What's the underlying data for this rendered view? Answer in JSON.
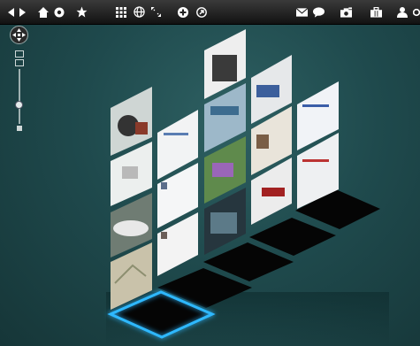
{
  "toolbar": {
    "left": [
      {
        "name": "back-icon"
      },
      {
        "name": "forward-icon"
      },
      {
        "name": "home-icon"
      },
      {
        "name": "history-icon"
      },
      {
        "name": "bookmark-star-icon"
      }
    ],
    "center": [
      {
        "name": "grid-view-icon"
      },
      {
        "name": "globe-icon"
      },
      {
        "name": "fullscreen-icon"
      },
      {
        "name": "add-icon"
      },
      {
        "name": "share-icon"
      }
    ],
    "right": [
      {
        "name": "mail-icon"
      },
      {
        "name": "chat-icon"
      },
      {
        "name": "camera-icon"
      },
      {
        "name": "briefcase-icon"
      },
      {
        "name": "user-icon"
      },
      {
        "name": "settings-icon"
      }
    ]
  },
  "wall": {
    "columns": 5,
    "rows": 4,
    "selected_tile": {
      "column": 1,
      "label": "selected-page-tile"
    }
  },
  "colors": {
    "background": "#1f4a4d",
    "toolbar": "#1c1c1c",
    "floor_tile": "#050505",
    "selection_glow": "#2fb8ff"
  }
}
